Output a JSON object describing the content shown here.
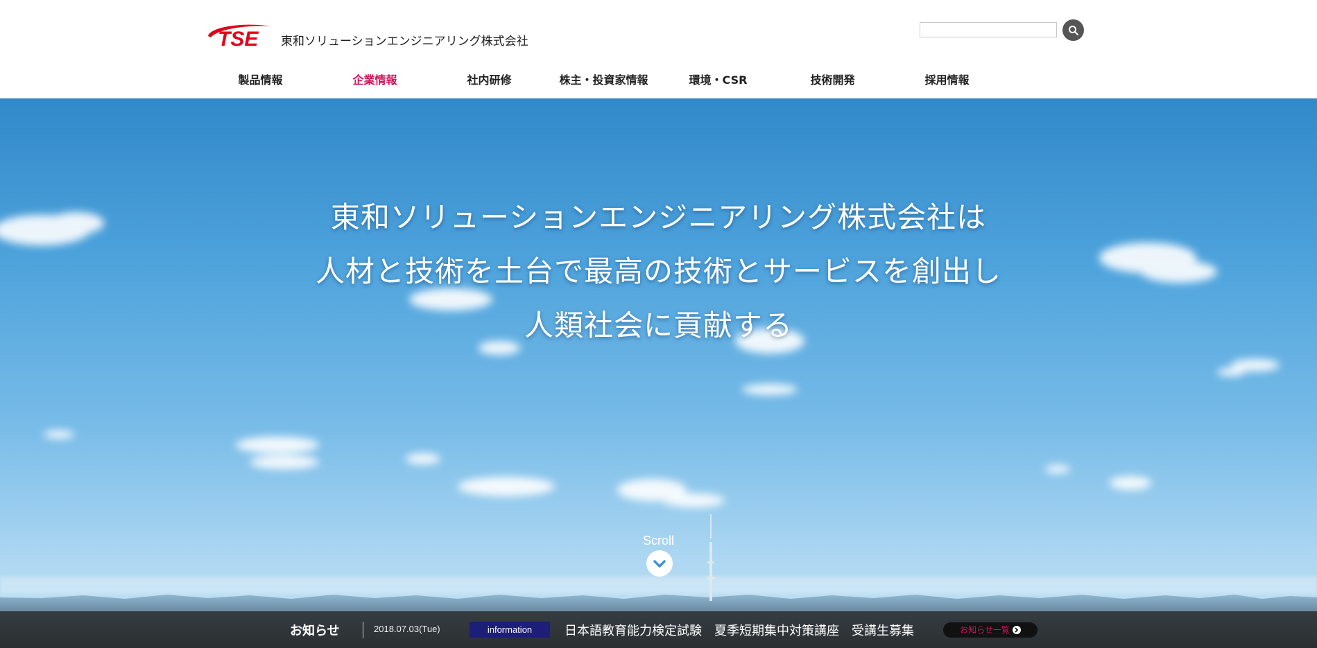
{
  "header": {
    "logo_text": "TSE",
    "company_name": "東和ソリューションエンジニアリング株式会社",
    "search": {
      "placeholder": "",
      "value": ""
    }
  },
  "nav": {
    "items": [
      {
        "label": "製品情報",
        "active": false
      },
      {
        "label": "企業情報",
        "active": true
      },
      {
        "label": "社内研修",
        "active": false
      },
      {
        "label": "株主・投資家情報",
        "active": false
      },
      {
        "label": "環境・CSR",
        "active": false
      },
      {
        "label": "技術開発",
        "active": false
      },
      {
        "label": "採用情報",
        "active": false
      }
    ]
  },
  "hero": {
    "lines": [
      "東和ソリューションエンジニアリング株式会社は",
      "人材と技術を土台で最高の技術とサービスを創出し",
      "人類社会に貢献する"
    ],
    "scroll_label": "Scroll"
  },
  "news": {
    "title": "お知らせ",
    "date": "2018.07.03(Tue)",
    "category": "information",
    "headline": "日本語教育能力検定試験　夏季短期集中対策講座　受講生募集",
    "more_label": "お知らせ一覧"
  },
  "colors": {
    "accent": "#d2145a",
    "category_badge": "#1d1d7a",
    "logo_red": "#e3001b"
  },
  "icons": {
    "search": "magnifier-icon",
    "scroll": "chevron-down-circle-icon",
    "more": "arrow-right-circle-icon"
  }
}
